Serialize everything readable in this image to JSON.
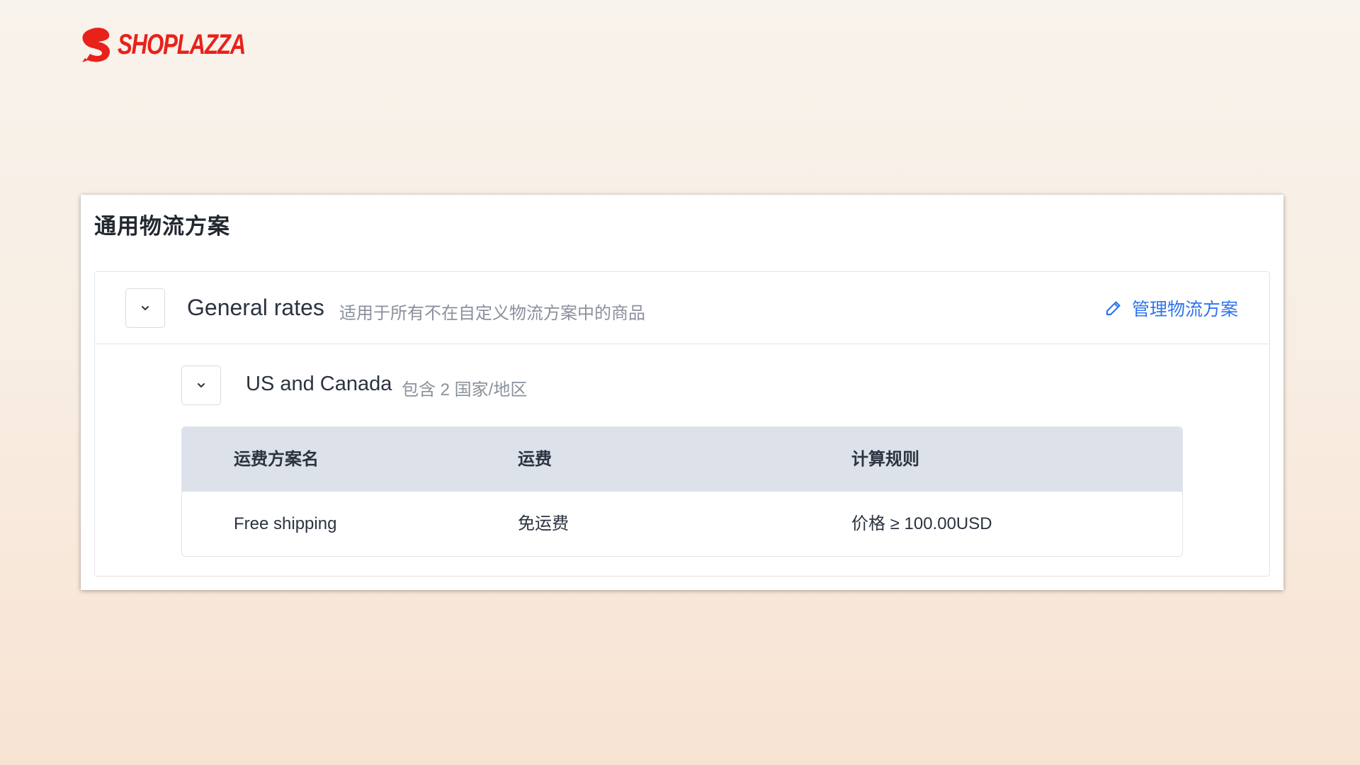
{
  "brand": {
    "name": "SHOPLAZZA",
    "color": "#e8211b"
  },
  "card": {
    "title": "通用物流方案"
  },
  "group": {
    "title": "General rates",
    "description": "适用于所有不在自定义物流方案中的商品",
    "toggle_icon": "chevron-down-icon",
    "manage_label": "管理物流方案",
    "manage_icon": "pencil-icon",
    "link_color": "#2f74f0"
  },
  "zone": {
    "title": "US and Canada",
    "description": "包含 2 国家/地区",
    "toggle_icon": "chevron-down-icon"
  },
  "rates_table": {
    "columns": [
      "运费方案名",
      "运费",
      "计算规则"
    ],
    "rows": [
      [
        "Free shipping",
        "免运费",
        "价格 ≥ 100.00USD"
      ]
    ]
  }
}
